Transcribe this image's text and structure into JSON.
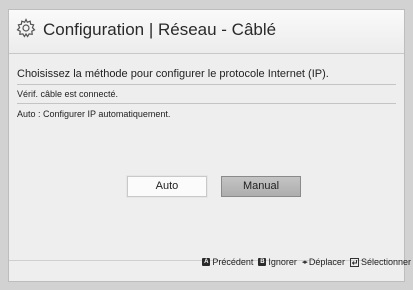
{
  "header": {
    "title": "Configuration | Réseau - Câblé",
    "icon": "gear-icon"
  },
  "content": {
    "subtitle": "Choisissez la méthode pour configurer le protocole Internet (IP).",
    "status": "Vérif. câble est connecté.",
    "description": "Auto : Configurer IP automatiquement."
  },
  "buttons": {
    "auto_label": "Auto",
    "manual_label": "Manual"
  },
  "footer": {
    "previous": {
      "key": "A",
      "label": "Précédent"
    },
    "ignore": {
      "key": "B",
      "label": "Ignorer"
    },
    "move": {
      "label": "Déplacer"
    },
    "select": {
      "label": "Sélectionner"
    }
  },
  "colors": {
    "background": "#d2d2d2",
    "panel": "#eeeeee",
    "selected_button": "#b8b8b8"
  }
}
